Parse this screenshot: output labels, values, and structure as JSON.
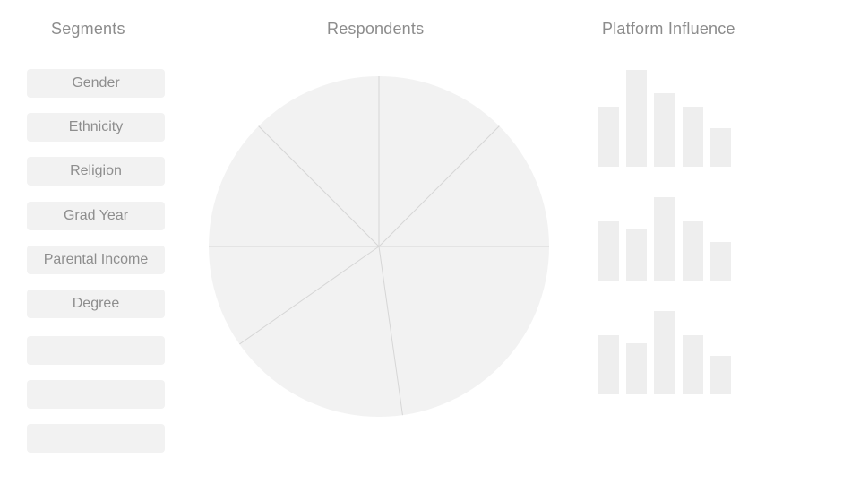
{
  "headers": {
    "segments": "Segments",
    "respondents": "Respondents",
    "platform": "Platform Influence"
  },
  "segments": [
    "Gender",
    "Ethnicity",
    "Religion",
    "Grad Year",
    "Parental Income",
    "Degree",
    "",
    "",
    ""
  ],
  "respondents_pie": {
    "slices": [
      1,
      1,
      1,
      1,
      1,
      1,
      1
    ],
    "slice_boundaries_deg": [
      0,
      45,
      90,
      172,
      235,
      270,
      315
    ],
    "fill": "#f2f2f2",
    "stroke": "#d6d6d6"
  },
  "platform_bars": {
    "bar_color": "#eeeeee",
    "groups": [
      {
        "values": [
          0.62,
          1.0,
          0.76,
          0.62,
          0.4
        ]
      },
      {
        "values": [
          0.71,
          0.61,
          1.0,
          0.71,
          0.46
        ]
      },
      {
        "values": [
          0.71,
          0.61,
          1.0,
          0.71,
          0.46
        ]
      }
    ]
  }
}
